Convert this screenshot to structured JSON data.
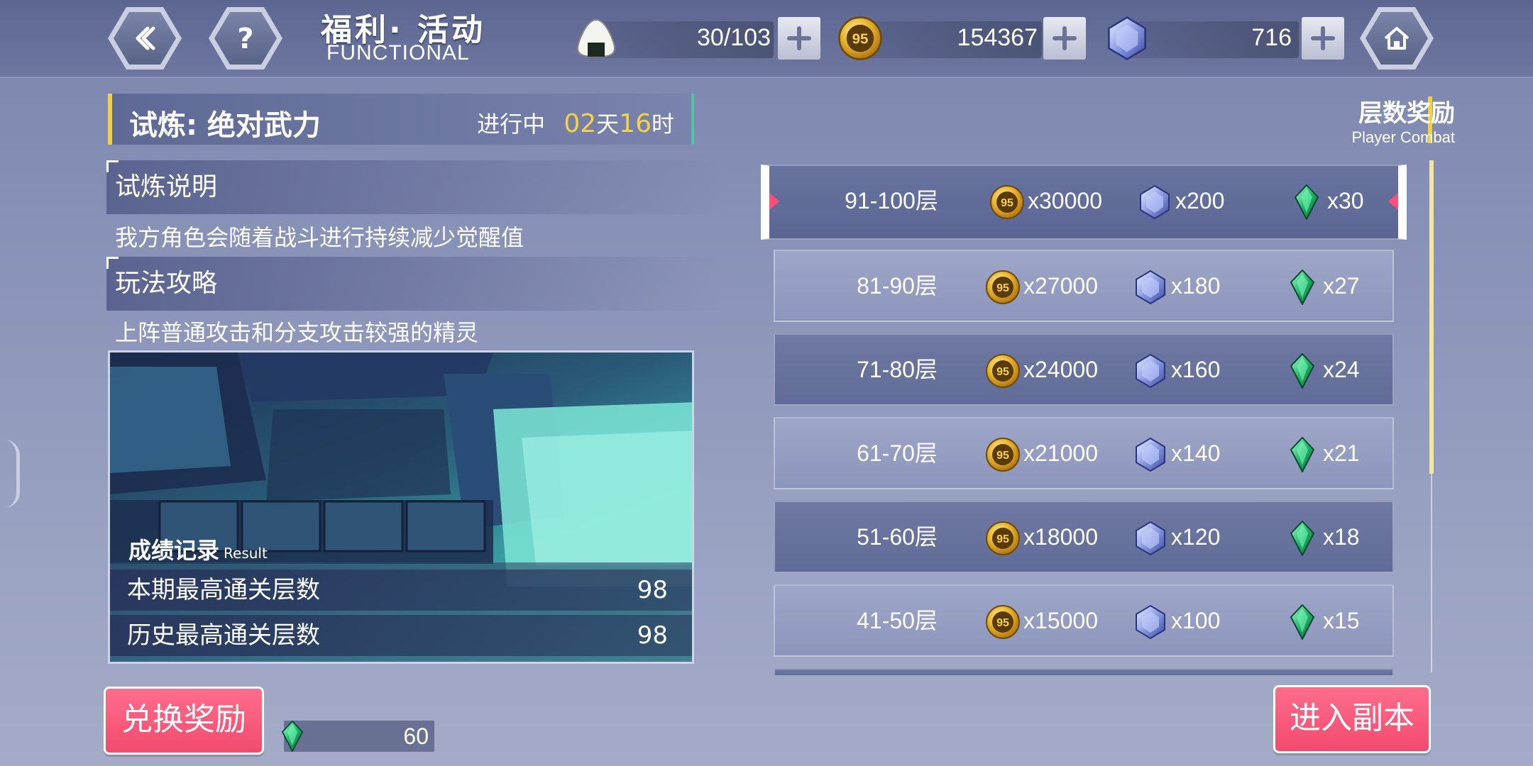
{
  "header": {
    "title_cn": "福利· 活动",
    "title_en": "FUNCTIONAL",
    "back_icon": "chevron-left-icon",
    "help_icon": "question-mark-icon",
    "home_icon": "home-icon"
  },
  "resources": {
    "stamina": {
      "icon": "rice-ball-icon",
      "value": "30/103"
    },
    "coins": {
      "icon": "gold-coin-icon",
      "value": "154367"
    },
    "crystals": {
      "icon": "blue-crystal-icon",
      "value": "716"
    }
  },
  "trial": {
    "title": "试炼: 绝对武力",
    "status_label": "进行中",
    "days": "02",
    "days_unit": "天",
    "hours": "16",
    "hours_unit": "时"
  },
  "sections": [
    {
      "heading": "试炼说明",
      "body": "我方角色会随着战斗进行持续减少觉醒值"
    },
    {
      "heading": "玩法攻略",
      "body": "上阵普通攻击和分支攻击较强的精灵"
    }
  ],
  "results": {
    "title": "成绩记录",
    "title_en": "Result",
    "rows": [
      {
        "label": "本期最高通关层数",
        "value": "98"
      },
      {
        "label": "历史最高通关层数",
        "value": "98"
      }
    ]
  },
  "rewards_header": {
    "cn": "层数奖励",
    "en": "Player Combat"
  },
  "tiers": [
    {
      "range": "91-100层",
      "coins": "x30000",
      "crystals": "x200",
      "gems": "x30",
      "selected": true
    },
    {
      "range": "81-90层",
      "coins": "x27000",
      "crystals": "x180",
      "gems": "x27"
    },
    {
      "range": "71-80层",
      "coins": "x24000",
      "crystals": "x160",
      "gems": "x24"
    },
    {
      "range": "61-70层",
      "coins": "x21000",
      "crystals": "x140",
      "gems": "x21"
    },
    {
      "range": "51-60层",
      "coins": "x18000",
      "crystals": "x120",
      "gems": "x18"
    },
    {
      "range": "41-50层",
      "coins": "x15000",
      "crystals": "x100",
      "gems": "x15"
    }
  ],
  "bottom": {
    "exchange_label": "兑换奖励",
    "enter_label": "进入副本",
    "token_icon": "green-gem-icon",
    "token_value": "60"
  },
  "colors": {
    "accent_yellow": "#f2d23c",
    "button_pink": "#f24a6e",
    "background": "#8a93b8"
  }
}
